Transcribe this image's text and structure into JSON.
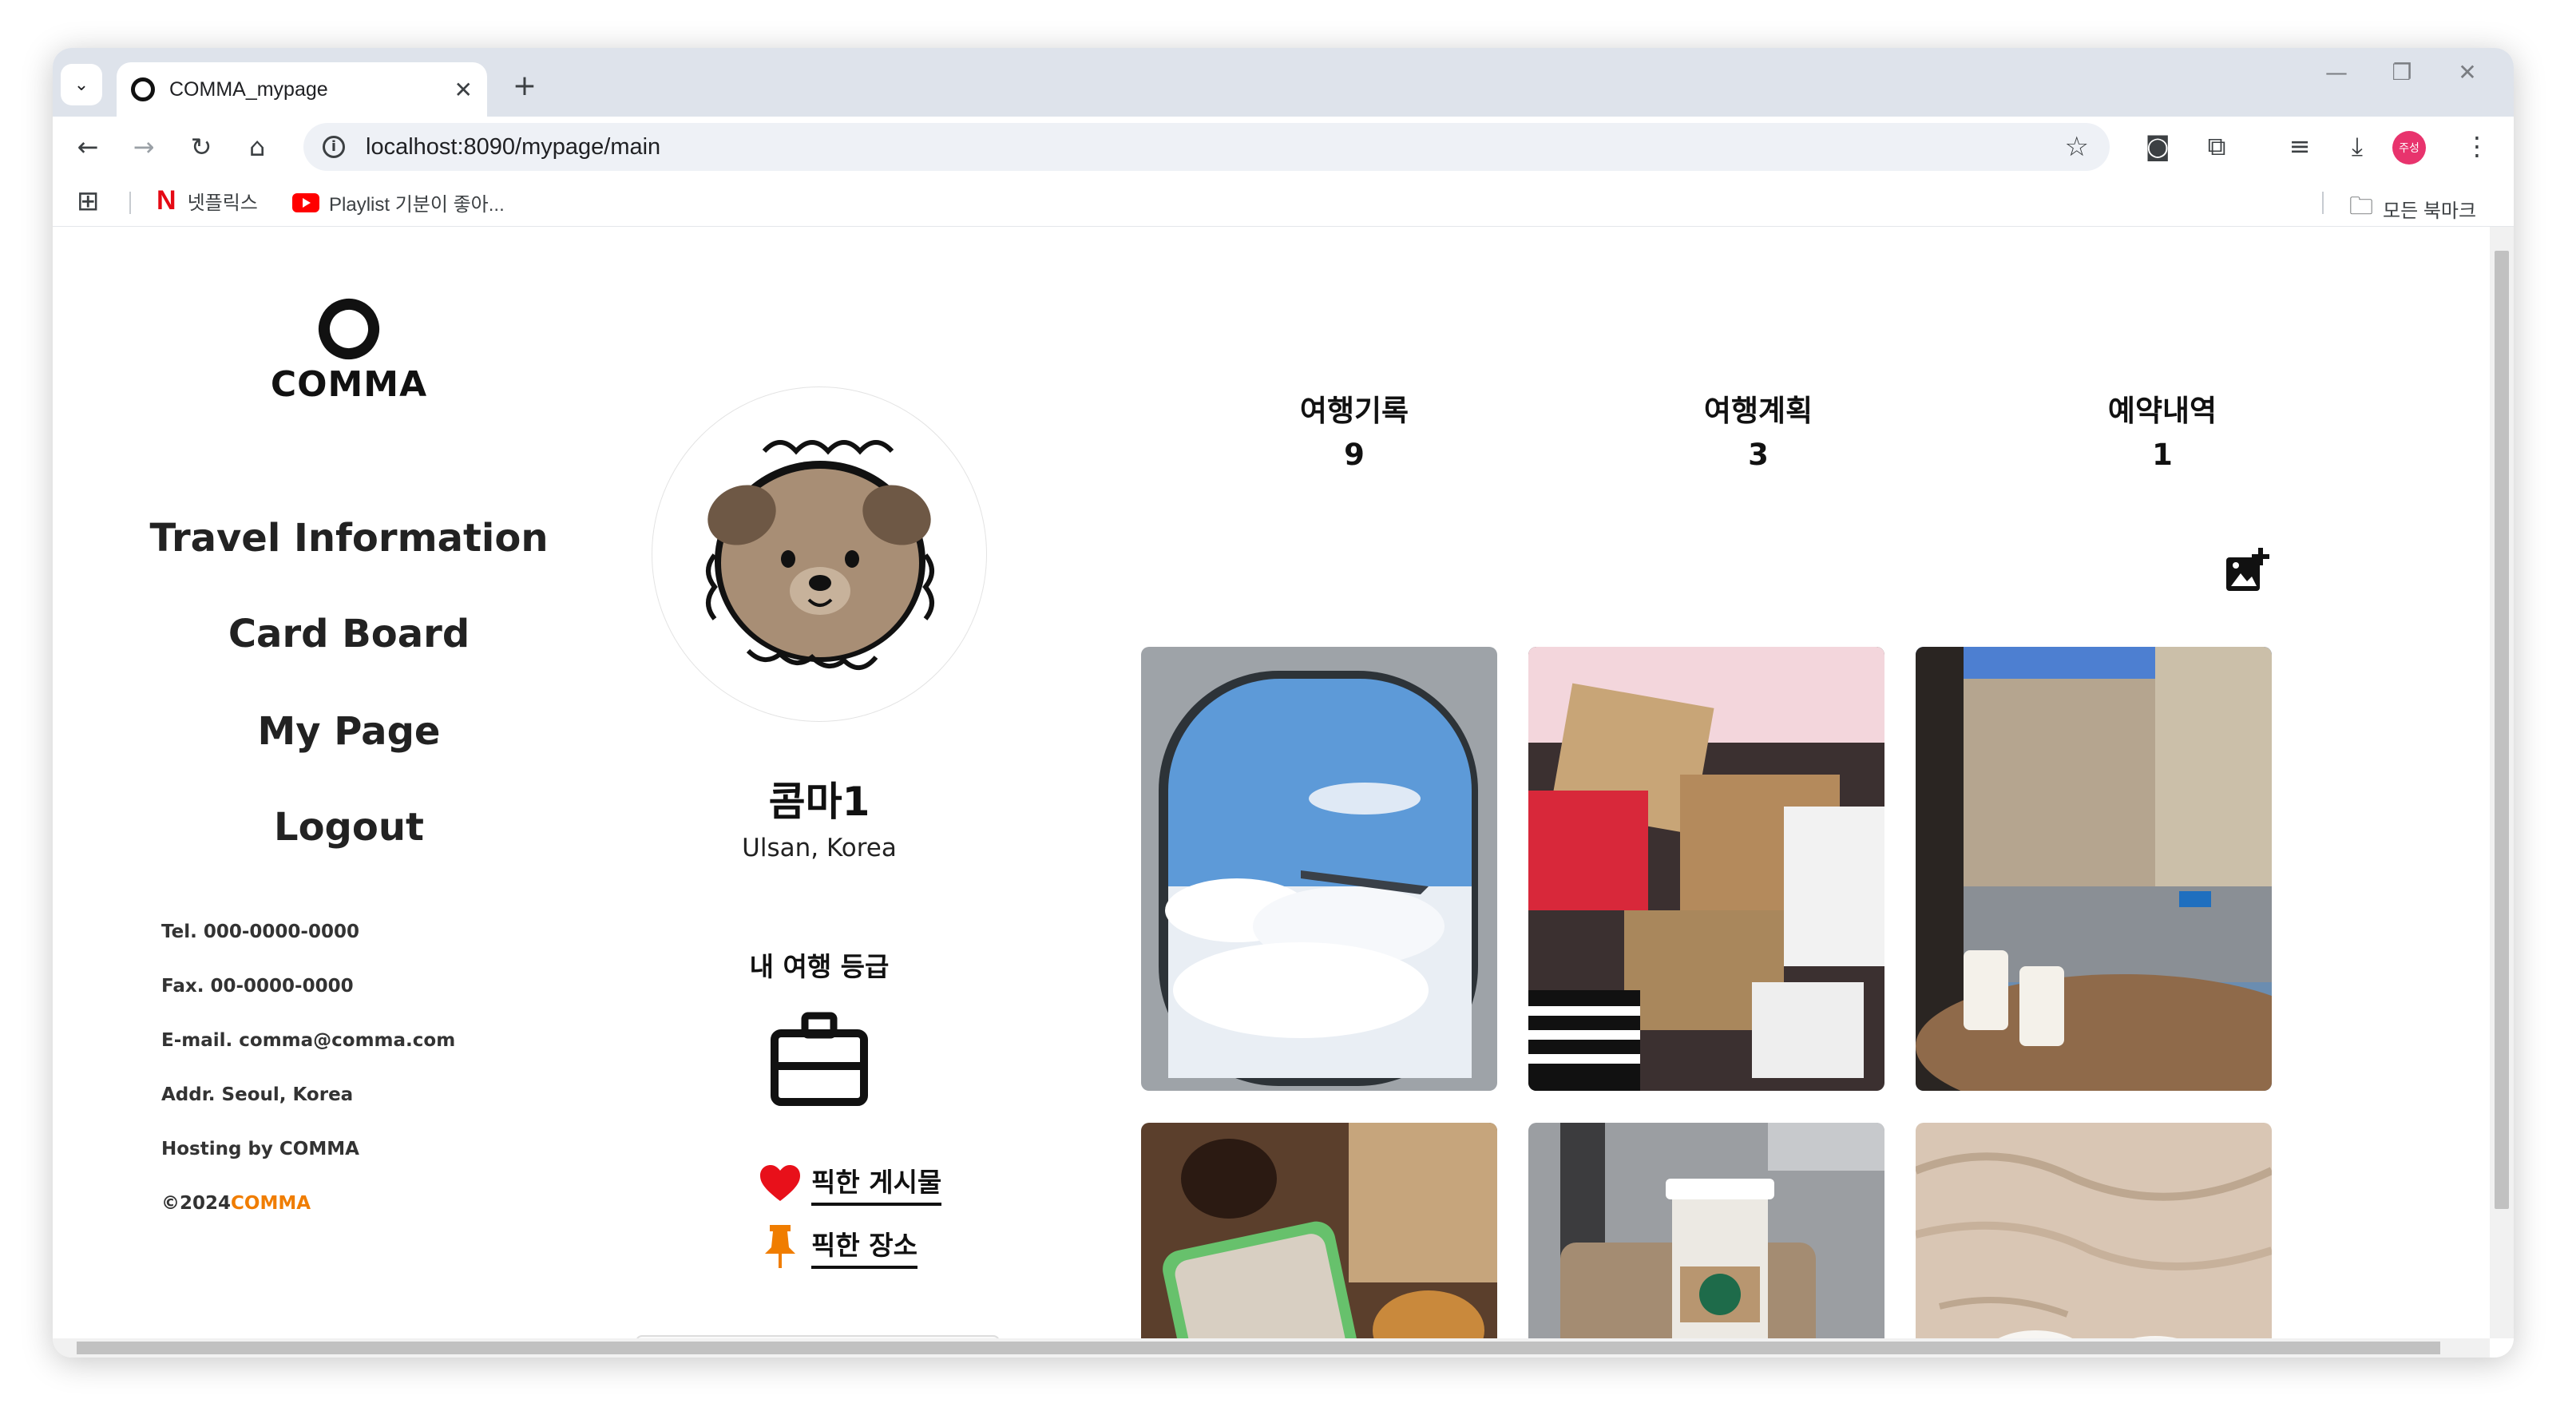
{
  "browser": {
    "tab_title": "COMMA_mypage",
    "url": "localhost:8090/mypage/main",
    "profile_initials": "주성",
    "bookmarks": [
      {
        "label": "넷플릭스"
      },
      {
        "label": "Playlist 기분이 좋아..."
      }
    ],
    "all_bookmarks_label": "모든 북마크"
  },
  "site": {
    "brand": "COMMA",
    "nav": [
      "Travel Information",
      "Card Board",
      "My Page",
      "Logout"
    ],
    "footer": {
      "tel": "Tel.  000-0000-0000",
      "fax": "Fax.  00-0000-0000",
      "email": "E-mail.  comma@comma.com",
      "addr": "Addr.  Seoul, Korea",
      "hosting": "Hosting by COMMA",
      "copyright_prefix": "©2024",
      "copyright_brand": "COMMA"
    }
  },
  "profile": {
    "username": "콤마1",
    "location": "Ulsan, Korea",
    "grade_title": "내 여행 등급",
    "picked_posts": "픽한 게시물",
    "picked_places": "픽한 장소"
  },
  "stats": [
    {
      "label": "여행기록",
      "value": "9"
    },
    {
      "label": "여행계획",
      "value": "3"
    },
    {
      "label": "예약내역",
      "value": "1"
    }
  ],
  "photos": [
    {
      "name": "photo-airplane-window"
    },
    {
      "name": "photo-shopping-bags"
    },
    {
      "name": "photo-cafe-street"
    },
    {
      "name": "photo-food-phone"
    },
    {
      "name": "photo-luggage-coffee"
    },
    {
      "name": "photo-beach-sand"
    }
  ],
  "colors": {
    "accent_orange": "#f07d00",
    "heart_red": "#e8101a",
    "pin_orange": "#f07d00"
  }
}
